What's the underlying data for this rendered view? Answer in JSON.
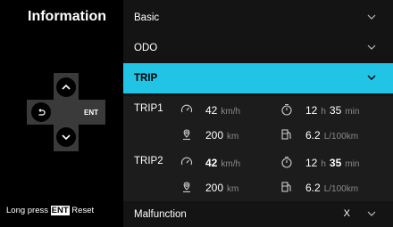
{
  "left_panel": {
    "title": "Information",
    "hint_prefix": "Long press",
    "hint_key": "ENT",
    "hint_suffix": "Reset",
    "dpad_center": "ENT"
  },
  "menu": {
    "basic": "Basic",
    "odo": "ODO",
    "trip": "TRIP",
    "malfunction": "Malfunction",
    "malfunction_status": "X"
  },
  "trips": [
    {
      "label": "TRIP1",
      "speed_value": "42",
      "speed_unit": "km/h",
      "time_h": "12",
      "time_h_unit": "h",
      "time_m": "35",
      "time_m_unit": "min",
      "distance_value": "200",
      "distance_unit": "km",
      "fuel_value": "6.2",
      "fuel_unit": "L/100km"
    },
    {
      "label": "TRIP2",
      "speed_value": "42",
      "speed_unit": "km/h",
      "time_h": "12",
      "time_h_unit": "h",
      "time_m": "35",
      "time_m_unit": "min",
      "distance_value": "200",
      "distance_unit": "km",
      "fuel_value": "6.2",
      "fuel_unit": "L/100km"
    }
  ],
  "colors": {
    "accent": "#22c4e6",
    "background": "#000000",
    "panel": "#141414",
    "unit_text": "#8a8a8a"
  }
}
